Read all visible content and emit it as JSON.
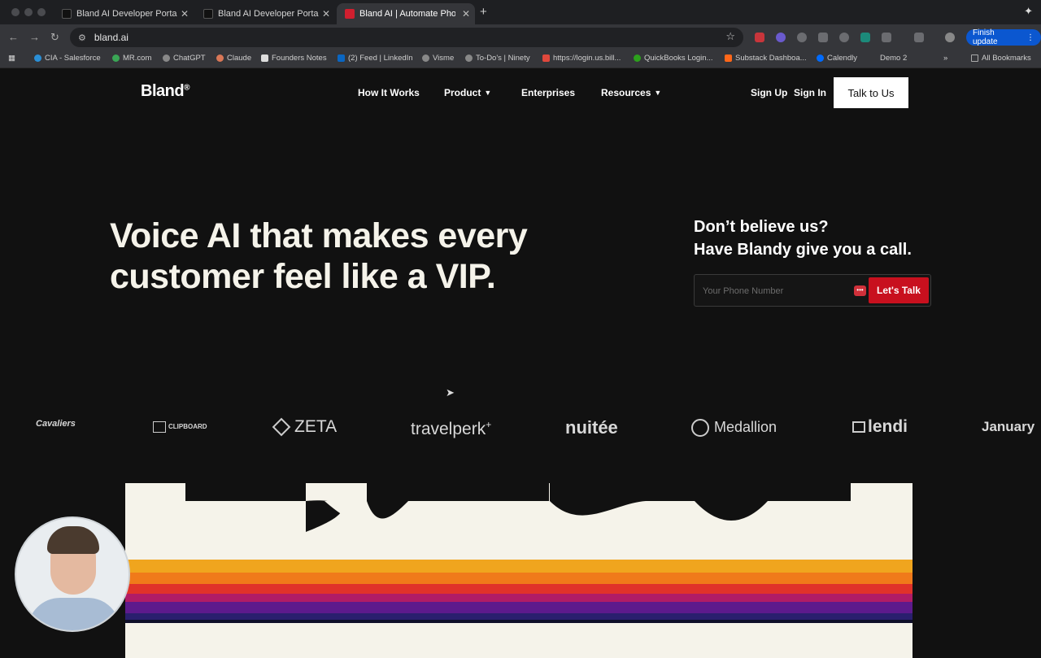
{
  "browser": {
    "tabs": [
      {
        "title": "Bland AI Developer Portal",
        "active": false
      },
      {
        "title": "Bland AI Developer Portal",
        "active": false
      },
      {
        "title": "Bland AI | Automate Phone Ca",
        "active": true
      }
    ],
    "url": "bland.ai",
    "finish_update": "Finish update",
    "bookmarks": [
      "CIA - Salesforce",
      "MR.com",
      "ChatGPT",
      "Claude",
      "Founders Notes",
      "(2) Feed | LinkedIn",
      "Visme",
      "To-Do's | Ninety",
      "https://login.us.bill...",
      "QuickBooks Login...",
      "Substack Dashboa...",
      "Calendly",
      "Demo 2"
    ],
    "all_bookmarks": "All Bookmarks"
  },
  "site": {
    "logo": "Bland",
    "logo_mark": "®",
    "nav": {
      "how_it_works": "How It Works",
      "product": "Product",
      "enterprises": "Enterprises",
      "resources": "Resources",
      "sign_up": "Sign Up",
      "sign_in": "Sign In",
      "talk_to_us": "Talk to Us"
    },
    "hero": {
      "line1": "Voice AI that makes every",
      "line2": "customer feel like a VIP."
    },
    "cta": {
      "line1": "Don’t believe us?",
      "line2": "Have Blandy give you a call.",
      "phone_placeholder": "Your Phone Number",
      "phone_value": "",
      "button": "Let's Talk"
    },
    "brands": [
      "Cavaliers",
      "CLIPBOARD",
      "ZETA",
      "travelperk",
      "nuitée",
      "Medallion",
      "lendi",
      "January"
    ],
    "banner_colors": [
      "#f0a51e",
      "#f07a1a",
      "#e0322a",
      "#b01c66",
      "#5d1a8c",
      "#2a1f6e",
      "#0f0f2a"
    ]
  }
}
